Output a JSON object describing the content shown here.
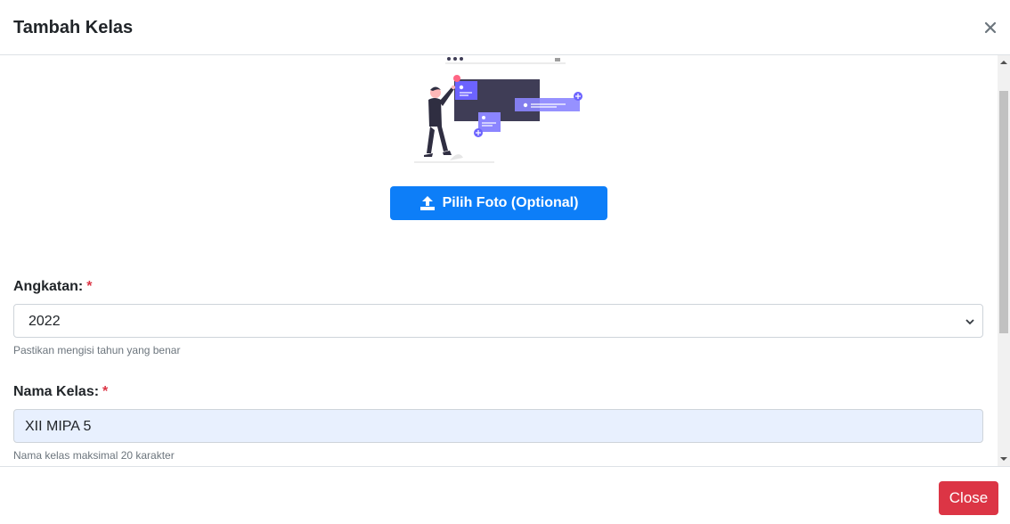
{
  "modal": {
    "title": "Tambah Kelas"
  },
  "upload": {
    "label": "Pilih Foto (Optional)"
  },
  "angkatan": {
    "label": "Angkatan:",
    "required_mark": "*",
    "selected": "2022",
    "help": "Pastikan mengisi tahun yang benar"
  },
  "nama_kelas": {
    "label": "Nama Kelas:",
    "required_mark": "*",
    "value": "XII MIPA 5",
    "help": "Nama kelas maksimal 20 karakter"
  },
  "footer": {
    "close_label": "Close"
  },
  "colors": {
    "primary": "#0d7ef8",
    "danger": "#dc3545",
    "autofill": "#e8f0fe",
    "illustration": "#6c63ff"
  },
  "icons": {
    "close": "close-icon",
    "upload": "upload-icon"
  }
}
